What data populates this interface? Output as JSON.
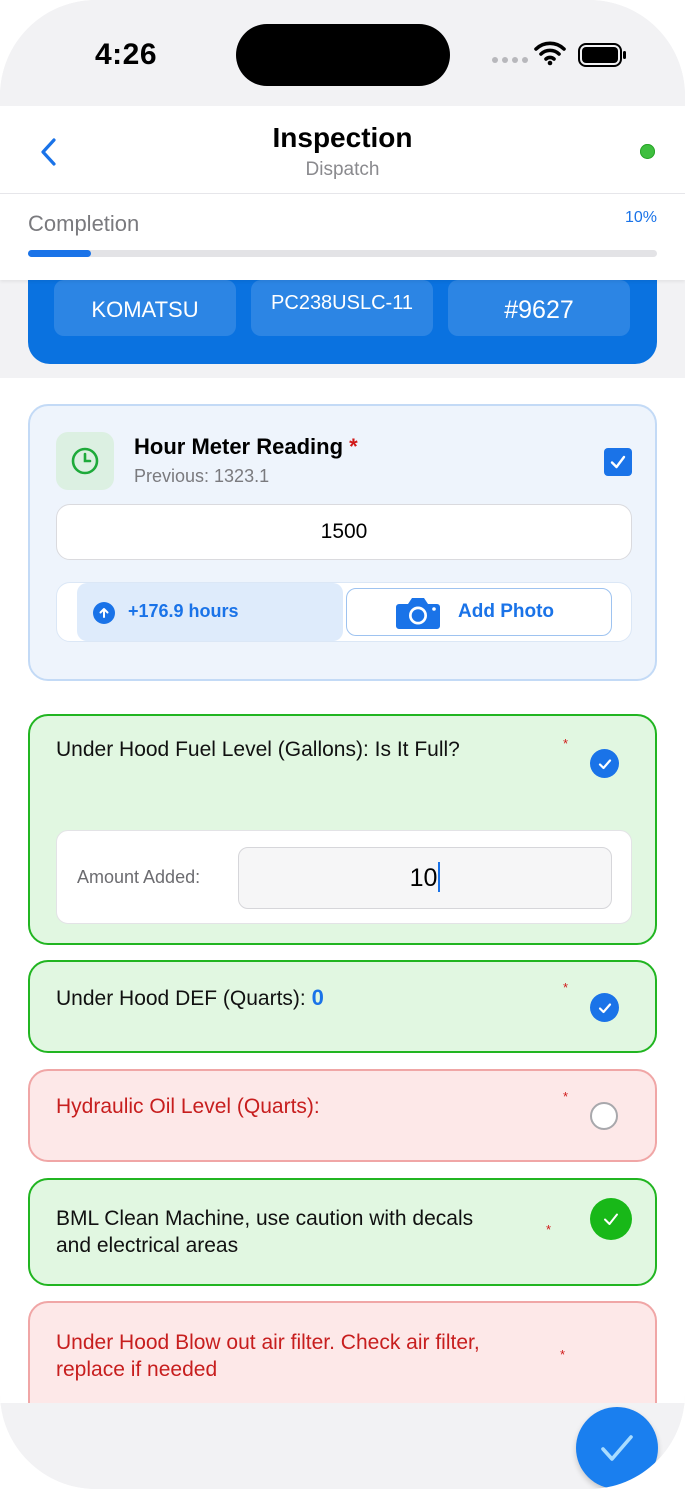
{
  "status_bar": {
    "time": "4:26"
  },
  "nav": {
    "title": "Inspection",
    "subtitle": "Dispatch"
  },
  "completion": {
    "label": "Completion",
    "percent_text": "10%",
    "progress": 0.1
  },
  "equipment": {
    "make": "KOMATSU",
    "model": "PC238USLC-11",
    "unit": "#9627"
  },
  "hour_meter": {
    "title": "Hour Meter Reading",
    "required_mark": "*",
    "previous": "Previous: 1323.1",
    "value": "1500",
    "delta": "+176.9 hours",
    "add_photo_label": "Add Photo",
    "checked": true
  },
  "questions": [
    {
      "text": "Under Hood Fuel Level (Gallons): Is It Full?",
      "required_mark": "*",
      "status": "blue-selected",
      "amount_label": "Amount Added:",
      "amount_value": "10"
    },
    {
      "text": "Under Hood DEF (Quarts):",
      "value": "0",
      "required_mark": "*",
      "status": "blue-selected"
    },
    {
      "text": "Hydraulic Oil Level (Quarts):",
      "required_mark": "*",
      "status": "unselected"
    },
    {
      "text_line1": "BML Clean Machine, use caution with decals",
      "text_line2": "and electrical areas",
      "required_mark": "*",
      "status": "green-checked"
    },
    {
      "text_line1": "Under Hood Blow out air filter. Check air filter,",
      "text_line2": "replace if needed",
      "required_mark": "*",
      "status": "unselected"
    }
  ],
  "colors": {
    "accent": "#1a73e8",
    "success": "#21b521",
    "error": "#c71e1e",
    "equipment_card": "#0a72e0"
  },
  "icons": [
    "back-chevron-icon",
    "sync-status-icon",
    "clock-icon",
    "checkbox-icon",
    "arrow-up-icon",
    "camera-icon",
    "checkmark-icon",
    "submit-check-icon"
  ]
}
